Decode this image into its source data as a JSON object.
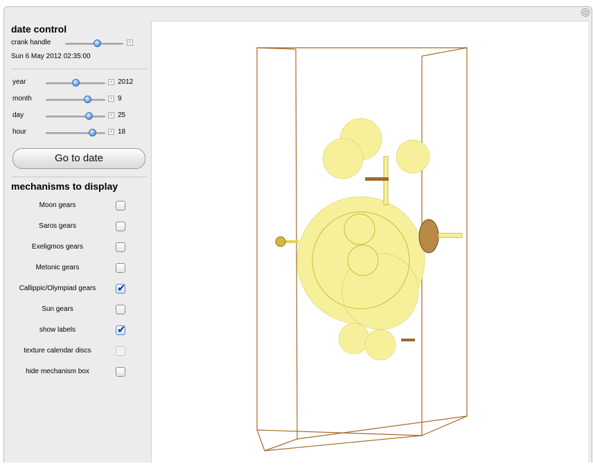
{
  "corner_icon": "⊙",
  "date_control": {
    "heading": "date control",
    "crank_label": "crank handle",
    "current_date": "Sun 6 May 2012 02:35:00"
  },
  "sliders": [
    {
      "label": "year",
      "value": "2012",
      "fraction": 0.5
    },
    {
      "label": "month",
      "value": "9",
      "fraction": 0.7
    },
    {
      "label": "day",
      "value": "25",
      "fraction": 0.72
    },
    {
      "label": "hour",
      "value": "18",
      "fraction": 0.78
    }
  ],
  "crank_fraction": 0.55,
  "go_button": "Go to date",
  "mechanisms": {
    "heading": "mechanisms to display",
    "items": [
      {
        "label": "Moon gears",
        "checked": false
      },
      {
        "label": "Saros gears",
        "checked": false
      },
      {
        "label": "Exeligmos gears",
        "checked": false
      },
      {
        "label": "Metonic gears",
        "checked": false
      },
      {
        "label": "Callippic/Olympiad gears",
        "checked": true
      },
      {
        "label": "Sun gears",
        "checked": false
      },
      {
        "label": "show labels",
        "checked": true
      },
      {
        "label": "texture calendar discs",
        "checked": false,
        "disabled": true
      },
      {
        "label": "hide mechanism box",
        "checked": false
      }
    ]
  },
  "colors": {
    "gear": "#f7f09a",
    "gear_edge": "#c9bd3a",
    "box_line": "#a46a26",
    "bronze": "#9b6a2b"
  }
}
